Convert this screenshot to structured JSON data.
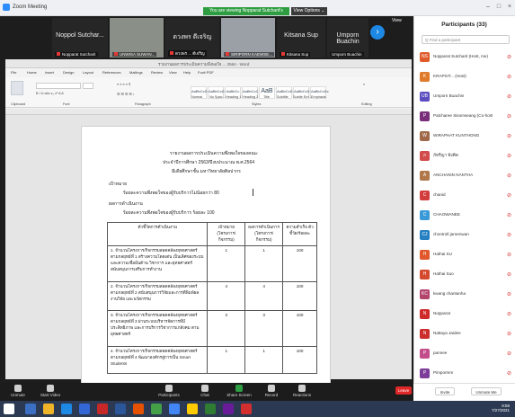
{
  "window": {
    "title": "Zoom Meeting"
  },
  "banner": {
    "text": "You are viewing Nopparat Sutcharit's screen"
  },
  "view_options": {
    "label": "View Options ⌄"
  },
  "view_button": {
    "label": "View"
  },
  "participants_strip": [
    {
      "name": "Noppol Sutchar...",
      "label": "Nopparat Sutcharit"
    },
    {
      "name": "",
      "label": "UNWISA SUWAN..."
    },
    {
      "name": "ดวงพร ดีเจริญ",
      "label": "ดวงพร ... ดีเจริญ"
    },
    {
      "name": "",
      "label": "SIRIPORN KAEWSE..."
    },
    {
      "name": "Kitsana Sup",
      "label": "Kitsana Sup"
    },
    {
      "name": "Umporn Buachin",
      "label": "Umporn Buachin"
    }
  ],
  "word": {
    "title": "รายงานผลการประเมินความพึงพอใจ ... 2564 - Word",
    "menu": [
      "File",
      "Home",
      "Insert",
      "Design",
      "Layout",
      "References",
      "Mailings",
      "Review",
      "View",
      "Help",
      "Foxit PDF"
    ],
    "styles": [
      "AaBbCcDc",
      "AaBbCcDc",
      "AaBbCc",
      "AaBbCcC",
      "AaB",
      "AaBbCcD",
      "AaBbCcD",
      "AaBbCcDc"
    ],
    "style_names": [
      "Normal",
      "No Spac...",
      "Heading 1",
      "Heading 2",
      "Title",
      "Subtitle",
      "Subtle Em...",
      "Emphasis"
    ],
    "groups": [
      "Clipboard",
      "Font",
      "Paragraph",
      "Styles",
      "Editing"
    ]
  },
  "document": {
    "heading1": "รายงานผลการประเมินความพึงพอใจของคณะ",
    "heading2": "ประจำปีการศึกษา 2563/ปีงบประมาณ พ.ศ.2564",
    "heading3": "มีเดียศึกษาชั้น มหาวิทยาลัยศิลปากร",
    "s1_title": "เป้าหมาย",
    "s1_text": "ร้อยละความพึงพอใจของผู้รับบริการไม่น้อยกว่า 80",
    "s2_title": "ผลการดำเนินงาน",
    "s2_text": "ร้อยละความพึงพอใจของผู้รับบริการ ร้อยละ 100",
    "table": {
      "headers": [
        "ตัวชี้วัดการดำเนินงาน",
        "เป้าหมาย (โครงการ/กิจกรรม)",
        "ผลการดำเนินการ (โครงการ/กิจกรรม)",
        "ความสำเร็จ ตัวชี้วัด/ร้อยละ"
      ],
      "rows": [
        [
          "1. จำนวนโครงการ/กิจกรรมสอดคล้องยุทธศาสตร์ ตามกลยุทธ์ที่ 1 สร้างความโดดเด่น เป็นเลิศของระบบ และความเชื่อมั่นด้าน วิชาการ และยุทธศาสตร์สนับสนุนการเสริมการทำงาน",
          "1",
          "1",
          "100"
        ],
        [
          "2. จำนวนโครงการ/กิจกรรมสอดคล้องยุทธศาสตร์ ตามกลยุทธ์ที่ 2 สนับสนุนการวิจัยและการตีพิมพ์ผลงานวิจัย และนวัตกรรม",
          "4",
          "4",
          "100"
        ],
        [
          "3. จำนวนโครงการ/กิจกรรมสอดคล้องยุทธศาสตร์ ตามกลยุทธ์ที่ 3 ผ่านระบบบริหารจัดการที่มีประสิทธิภาพ และการบริการวิชาการแก่สังคม ตามยุทธศาสตร์",
          "3",
          "3",
          "100"
        ],
        [
          "4. จำนวนโครงการ/กิจกรรมสอดคล้องยุทธศาสตร์ ตามกลยุทธ์ที่ 4 พัฒนาองค์กรสู่การเป็น Smart Students",
          "1",
          "1",
          "100"
        ]
      ]
    }
  },
  "controls": [
    {
      "label": "Unmute"
    },
    {
      "label": "Start Video"
    },
    {
      "label": "Participants"
    },
    {
      "label": "Chat"
    },
    {
      "label": "Share Screen"
    },
    {
      "label": "Record"
    },
    {
      "label": "Reactions"
    }
  ],
  "leave_button": {
    "label": "Leave"
  },
  "panel": {
    "title": "Participants (33)",
    "search_placeholder": "Q Find a participant",
    "participants": [
      {
        "name": "Nopparat Sutcharit (Host, me)",
        "initial": "NS",
        "color": "#e05b2b"
      },
      {
        "name": "KRAPSIT... (Host)",
        "initial": "K",
        "color": "#e07b2b"
      },
      {
        "name": "Umporn Buachin",
        "initial": "UB",
        "color": "#5c4ec0"
      },
      {
        "name": "Patcharee Sisomseang (Co-host)",
        "initial": "P",
        "color": "#7a2e7a"
      },
      {
        "name": "WIRAPHAT KUNTHONG",
        "initial": "W",
        "color": "#a06a4a"
      },
      {
        "name": "ภัทรีญา ฟังคิด",
        "initial": "ภ",
        "color": "#d24c4c"
      },
      {
        "name": "ANCHANIN NANTHA",
        "initial": "A",
        "color": "#b0784a"
      },
      {
        "name": "chanid",
        "initial": "C",
        "color": "#d33c3c"
      },
      {
        "name": "CHAOWANEE",
        "initial": "C",
        "color": "#3a9ad8"
      },
      {
        "name": "chontroll jaroenwan",
        "initial": "CJ",
        "color": "#2680c2"
      },
      {
        "name": "Hathai SU",
        "initial": "H",
        "color": "#e0582b"
      },
      {
        "name": "Hathai Suo",
        "initial": "H",
        "color": "#d54a2e"
      },
      {
        "name": "kwang  chantanha",
        "initial": "KC",
        "color": "#b3446c"
      },
      {
        "name": "Nopparat",
        "initial": "N",
        "color": "#d02b2b"
      },
      {
        "name": "Nattaya  Jaidee",
        "initial": "N",
        "color": "#cc2e2e"
      },
      {
        "name": "pannee",
        "initial": "P",
        "color": "#c24d8a"
      },
      {
        "name": "Pimpormm",
        "initial": "P",
        "color": "#7c3e9a"
      }
    ],
    "invite_label": "Invite",
    "unmute_me_label": "Unmute Me"
  },
  "taskbar": {
    "time": "9:59",
    "date": "7/27/2021"
  }
}
